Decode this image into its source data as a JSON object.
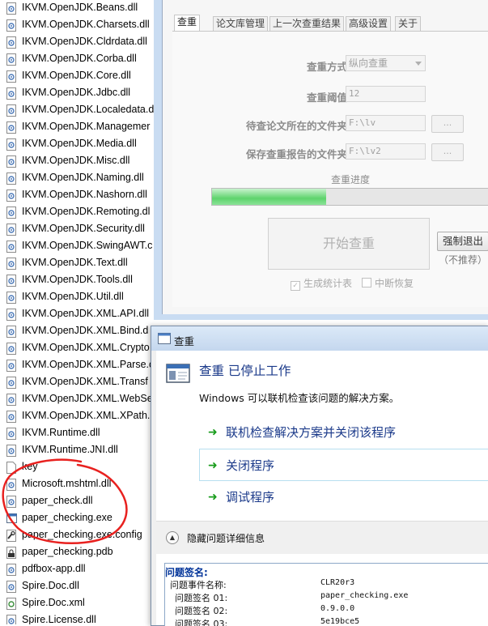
{
  "file_list": [
    {
      "name": "IKVM.OpenJDK.Beans.dll",
      "icon": "dll-icon"
    },
    {
      "name": "IKVM.OpenJDK.Charsets.dll",
      "icon": "dll-icon"
    },
    {
      "name": "IKVM.OpenJDK.Cldrdata.dll",
      "icon": "dll-icon"
    },
    {
      "name": "IKVM.OpenJDK.Corba.dll",
      "icon": "dll-icon"
    },
    {
      "name": "IKVM.OpenJDK.Core.dll",
      "icon": "dll-icon"
    },
    {
      "name": "IKVM.OpenJDK.Jdbc.dll",
      "icon": "dll-icon"
    },
    {
      "name": "IKVM.OpenJDK.Localedata.d",
      "icon": "dll-icon"
    },
    {
      "name": "IKVM.OpenJDK.Managemer",
      "icon": "dll-icon"
    },
    {
      "name": "IKVM.OpenJDK.Media.dll",
      "icon": "dll-icon"
    },
    {
      "name": "IKVM.OpenJDK.Misc.dll",
      "icon": "dll-icon"
    },
    {
      "name": "IKVM.OpenJDK.Naming.dll",
      "icon": "dll-icon"
    },
    {
      "name": "IKVM.OpenJDK.Nashorn.dll",
      "icon": "dll-icon"
    },
    {
      "name": "IKVM.OpenJDK.Remoting.dl",
      "icon": "dll-icon"
    },
    {
      "name": "IKVM.OpenJDK.Security.dll",
      "icon": "dll-icon"
    },
    {
      "name": "IKVM.OpenJDK.SwingAWT.c",
      "icon": "dll-icon"
    },
    {
      "name": "IKVM.OpenJDK.Text.dll",
      "icon": "dll-icon"
    },
    {
      "name": "IKVM.OpenJDK.Tools.dll",
      "icon": "dll-icon"
    },
    {
      "name": "IKVM.OpenJDK.Util.dll",
      "icon": "dll-icon"
    },
    {
      "name": "IKVM.OpenJDK.XML.API.dll",
      "icon": "dll-icon"
    },
    {
      "name": "IKVM.OpenJDK.XML.Bind.d",
      "icon": "dll-icon"
    },
    {
      "name": "IKVM.OpenJDK.XML.Crypto",
      "icon": "dll-icon"
    },
    {
      "name": "IKVM.OpenJDK.XML.Parse.c",
      "icon": "dll-icon"
    },
    {
      "name": "IKVM.OpenJDK.XML.Transf",
      "icon": "dll-icon"
    },
    {
      "name": "IKVM.OpenJDK.XML.WebSe",
      "icon": "dll-icon"
    },
    {
      "name": "IKVM.OpenJDK.XML.XPath.",
      "icon": "dll-icon"
    },
    {
      "name": "IKVM.Runtime.dll",
      "icon": "dll-icon"
    },
    {
      "name": "IKVM.Runtime.JNI.dll",
      "icon": "dll-icon"
    },
    {
      "name": "key",
      "icon": "blank-file-icon"
    },
    {
      "name": "Microsoft.mshtml.dll",
      "icon": "dll-icon"
    },
    {
      "name": "paper_check.dll",
      "icon": "dll-icon"
    },
    {
      "name": "paper_checking.exe",
      "icon": "exe-icon"
    },
    {
      "name": "paper_checking.exe.config",
      "icon": "config-icon"
    },
    {
      "name": "paper_checking.pdb",
      "icon": "pdb-icon"
    },
    {
      "name": "pdfbox-app.dll",
      "icon": "dll-icon"
    },
    {
      "name": "Spire.Doc.dll",
      "icon": "dll-icon"
    },
    {
      "name": "Spire.Doc.xml",
      "icon": "xml-icon"
    },
    {
      "name": "Spire.License.dll",
      "icon": "dll-icon"
    }
  ],
  "app": {
    "tabs": [
      "查重",
      "论文库管理",
      "上一次查重结果",
      "高级设置",
      "关于"
    ],
    "active_tab": 0,
    "form": {
      "mode_label": "查重方式",
      "mode_value": "纵向查重",
      "threshold_label": "查重阈值",
      "threshold_value": "12",
      "input_dir_label": "待查论文所在的文件夹",
      "input_dir_value": "F:\\lv",
      "output_dir_label": "保存查重报告的文件夹",
      "output_dir_value": "F:\\lv2",
      "browse_label": "..."
    },
    "progress_label": "查重进度",
    "progress_fraction": 0.41,
    "start_label": "开始查重",
    "force_exit_label": "强制退出",
    "not_recommended": "（不推荐）",
    "gen_stats_label": "生成统计表",
    "gen_stats_checked": true,
    "resume_label": "中断恢复",
    "resume_checked": false
  },
  "dialog": {
    "title": "查重",
    "heading": "查重 已停止工作",
    "description": "Windows 可以联机检查该问题的解决方案。",
    "options": [
      {
        "label": "联机检查解决方案并关闭该程序",
        "selected": false
      },
      {
        "label": "关闭程序",
        "selected": true
      },
      {
        "label": "调试程序",
        "selected": false
      }
    ],
    "details_toggle_label": "隐藏问题详细信息",
    "signature_title": "问题签名:",
    "signature_rows": [
      {
        "key": "问题事件名称:",
        "value": "CLR20r3"
      },
      {
        "key": "问题签名 01:",
        "value": "paper_checking.exe"
      },
      {
        "key": "问题签名 02:",
        "value": "0.9.0.0"
      },
      {
        "key": "问题签名 03:",
        "value": "5e19bce5"
      }
    ]
  },
  "colors": {
    "annotation_circle": "#e8211f",
    "progress_fill": "#5ed36c",
    "dialog_heading": "#1b3a8a",
    "option_arrow": "#199c1c"
  }
}
